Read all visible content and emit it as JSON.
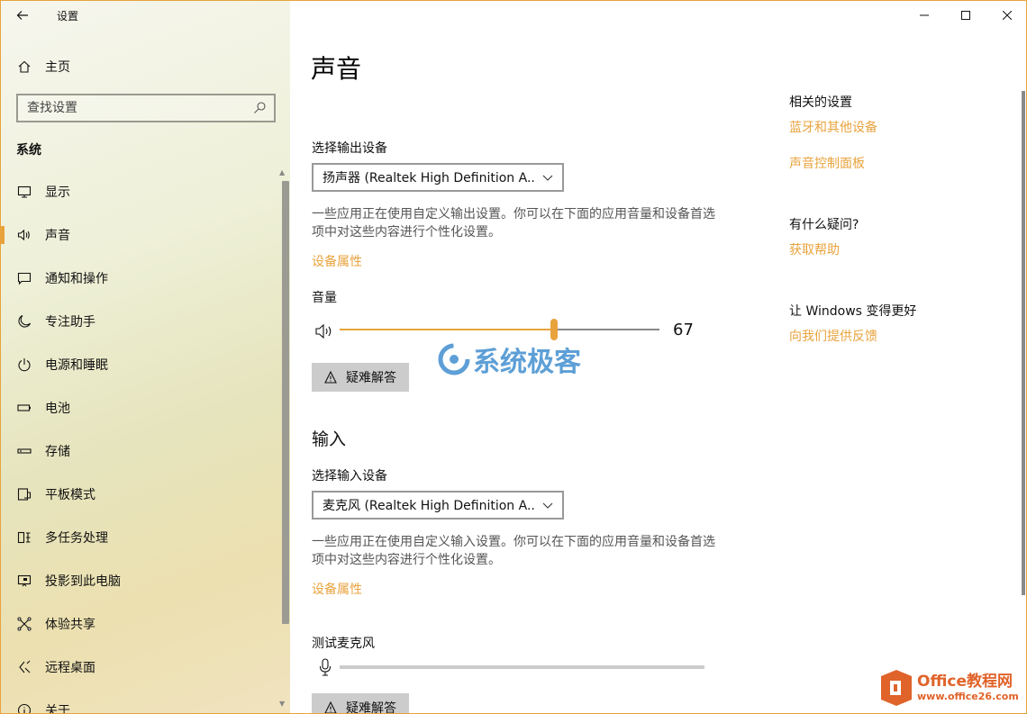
{
  "colors": {
    "accent": "#e8a33d",
    "link": "#e8a33d",
    "text": "#111111",
    "muted": "#555555"
  },
  "titlebar": {
    "title": "设置"
  },
  "sidebar": {
    "home_label": "主页",
    "search_placeholder": "查找设置",
    "section": "系统",
    "items": [
      {
        "label": "显示",
        "icon": "monitor-icon"
      },
      {
        "label": "声音",
        "icon": "speaker-icon",
        "active": true
      },
      {
        "label": "通知和操作",
        "icon": "notification-icon"
      },
      {
        "label": "专注助手",
        "icon": "moon-icon"
      },
      {
        "label": "电源和睡眠",
        "icon": "power-icon"
      },
      {
        "label": "电池",
        "icon": "battery-icon"
      },
      {
        "label": "存储",
        "icon": "storage-icon"
      },
      {
        "label": "平板模式",
        "icon": "tablet-icon"
      },
      {
        "label": "多任务处理",
        "icon": "multitask-icon"
      },
      {
        "label": "投影到此电脑",
        "icon": "project-icon"
      },
      {
        "label": "体验共享",
        "icon": "share-icon"
      },
      {
        "label": "远程桌面",
        "icon": "remote-icon"
      },
      {
        "label": "关于",
        "icon": "info-icon"
      }
    ]
  },
  "main": {
    "title": "声音",
    "output": {
      "label": "选择输出设备",
      "device": "扬声器 (Realtek High Definition A...",
      "desc": "一些应用正在使用自定义输出设置。你可以在下面的应用音量和设备首选项中对这些内容进行个性化设置。",
      "props_link": "设备属性",
      "volume_label": "音量",
      "volume_value": "67",
      "volume_percent": 67,
      "troubleshoot": "疑难解答"
    },
    "input": {
      "heading": "输入",
      "label": "选择输入设备",
      "device": "麦克风 (Realtek High Definition A...",
      "desc": "一些应用正在使用自定义输入设置。你可以在下面的应用音量和设备首选项中对这些内容进行个性化设置。",
      "props_link": "设备属性",
      "test_label": "测试麦克风",
      "troubleshoot": "疑难解答"
    }
  },
  "related": {
    "heading": "相关的设置",
    "link1": "蓝牙和其他设备",
    "link2": "声音控制面板",
    "question_heading": "有什么疑问?",
    "help_link": "获取帮助",
    "improve_heading": "让 Windows 变得更好",
    "feedback_link": "向我们提供反馈"
  },
  "watermarks": {
    "wm1": "系统极客",
    "wm2_line1": "Office教程网",
    "wm2_line2": "www.office26.com"
  }
}
